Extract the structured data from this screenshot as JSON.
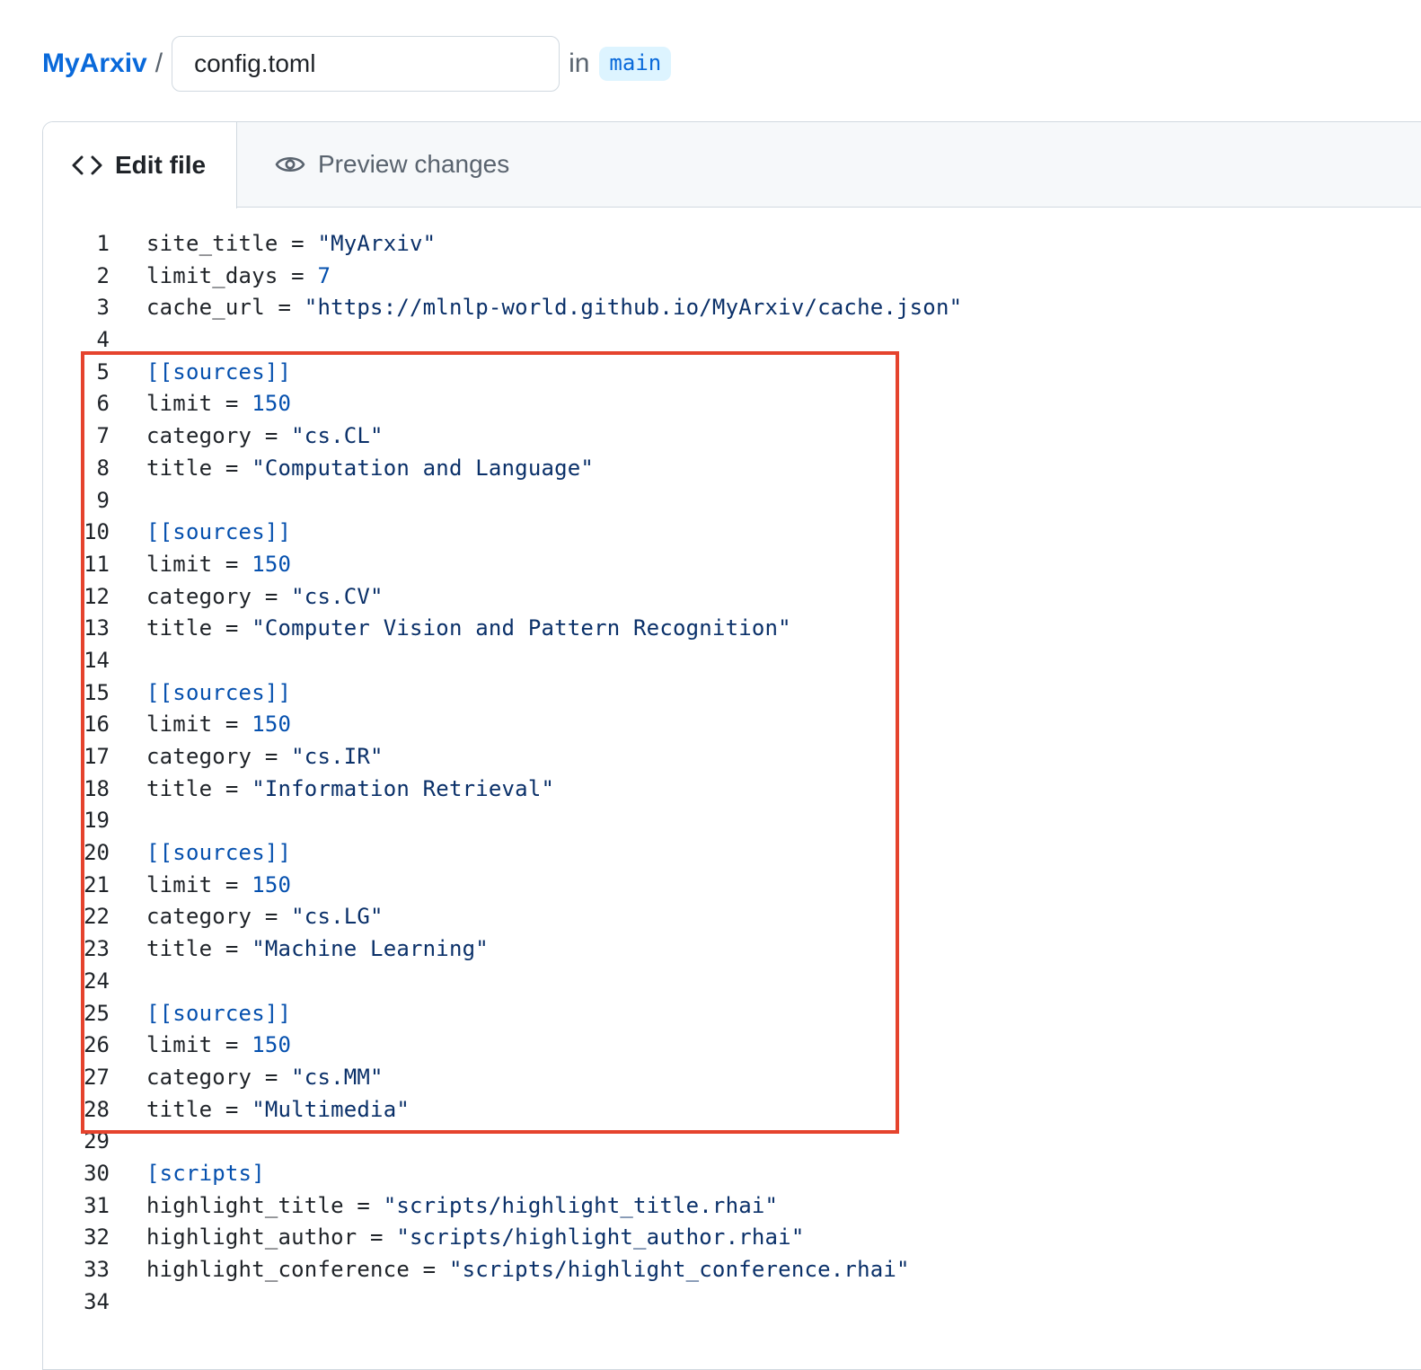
{
  "breadcrumb": {
    "repo": "MyArxiv",
    "separator": "/",
    "filename": "config.toml",
    "in_label": "in",
    "branch": "main"
  },
  "tabs": {
    "edit": {
      "label": "Edit file",
      "icon": "code-icon",
      "active": true
    },
    "preview": {
      "label": "Preview changes",
      "icon": "eye-icon",
      "active": false
    }
  },
  "code_lines": [
    {
      "n": "1",
      "tokens": [
        {
          "t": "site_title",
          "c": "key"
        },
        {
          "t": " = ",
          "c": "op"
        },
        {
          "t": "\"MyArxiv\"",
          "c": "str"
        }
      ]
    },
    {
      "n": "2",
      "tokens": [
        {
          "t": "limit_days",
          "c": "key"
        },
        {
          "t": " = ",
          "c": "op"
        },
        {
          "t": "7",
          "c": "num"
        }
      ]
    },
    {
      "n": "3",
      "tokens": [
        {
          "t": "cache_url",
          "c": "key"
        },
        {
          "t": " = ",
          "c": "op"
        },
        {
          "t": "\"https://mlnlp-world.github.io/MyArxiv/cache.json\"",
          "c": "str"
        }
      ]
    },
    {
      "n": "4",
      "tokens": []
    },
    {
      "n": "5",
      "tokens": [
        {
          "t": "[[sources]]",
          "c": "sec"
        }
      ]
    },
    {
      "n": "6",
      "tokens": [
        {
          "t": "limit",
          "c": "key"
        },
        {
          "t": " = ",
          "c": "op"
        },
        {
          "t": "150",
          "c": "num"
        }
      ]
    },
    {
      "n": "7",
      "tokens": [
        {
          "t": "category",
          "c": "key"
        },
        {
          "t": " = ",
          "c": "op"
        },
        {
          "t": "\"cs.CL\"",
          "c": "str"
        }
      ]
    },
    {
      "n": "8",
      "tokens": [
        {
          "t": "title",
          "c": "key"
        },
        {
          "t": " = ",
          "c": "op"
        },
        {
          "t": "\"Computation and Language\"",
          "c": "str"
        }
      ]
    },
    {
      "n": "9",
      "tokens": []
    },
    {
      "n": "10",
      "tokens": [
        {
          "t": "[[sources]]",
          "c": "sec"
        }
      ]
    },
    {
      "n": "11",
      "tokens": [
        {
          "t": "limit",
          "c": "key"
        },
        {
          "t": " = ",
          "c": "op"
        },
        {
          "t": "150",
          "c": "num"
        }
      ]
    },
    {
      "n": "12",
      "tokens": [
        {
          "t": "category",
          "c": "key"
        },
        {
          "t": " = ",
          "c": "op"
        },
        {
          "t": "\"cs.CV\"",
          "c": "str"
        }
      ]
    },
    {
      "n": "13",
      "tokens": [
        {
          "t": "title",
          "c": "key"
        },
        {
          "t": " = ",
          "c": "op"
        },
        {
          "t": "\"Computer Vision and Pattern Recognition\"",
          "c": "str"
        }
      ]
    },
    {
      "n": "14",
      "tokens": []
    },
    {
      "n": "15",
      "tokens": [
        {
          "t": "[[sources]]",
          "c": "sec"
        }
      ]
    },
    {
      "n": "16",
      "tokens": [
        {
          "t": "limit",
          "c": "key"
        },
        {
          "t": " = ",
          "c": "op"
        },
        {
          "t": "150",
          "c": "num"
        }
      ]
    },
    {
      "n": "17",
      "tokens": [
        {
          "t": "category",
          "c": "key"
        },
        {
          "t": " = ",
          "c": "op"
        },
        {
          "t": "\"cs.IR\"",
          "c": "str"
        }
      ]
    },
    {
      "n": "18",
      "tokens": [
        {
          "t": "title",
          "c": "key"
        },
        {
          "t": " = ",
          "c": "op"
        },
        {
          "t": "\"Information Retrieval\"",
          "c": "str"
        }
      ]
    },
    {
      "n": "19",
      "tokens": []
    },
    {
      "n": "20",
      "tokens": [
        {
          "t": "[[sources]]",
          "c": "sec"
        }
      ]
    },
    {
      "n": "21",
      "tokens": [
        {
          "t": "limit",
          "c": "key"
        },
        {
          "t": " = ",
          "c": "op"
        },
        {
          "t": "150",
          "c": "num"
        }
      ]
    },
    {
      "n": "22",
      "tokens": [
        {
          "t": "category",
          "c": "key"
        },
        {
          "t": " = ",
          "c": "op"
        },
        {
          "t": "\"cs.LG\"",
          "c": "str"
        }
      ]
    },
    {
      "n": "23",
      "tokens": [
        {
          "t": "title",
          "c": "key"
        },
        {
          "t": " = ",
          "c": "op"
        },
        {
          "t": "\"Machine Learning\"",
          "c": "str"
        }
      ]
    },
    {
      "n": "24",
      "tokens": []
    },
    {
      "n": "25",
      "tokens": [
        {
          "t": "[[sources]]",
          "c": "sec"
        }
      ]
    },
    {
      "n": "26",
      "tokens": [
        {
          "t": "limit",
          "c": "key"
        },
        {
          "t": " = ",
          "c": "op"
        },
        {
          "t": "150",
          "c": "num"
        }
      ]
    },
    {
      "n": "27",
      "tokens": [
        {
          "t": "category",
          "c": "key"
        },
        {
          "t": " = ",
          "c": "op"
        },
        {
          "t": "\"cs.MM\"",
          "c": "str"
        }
      ]
    },
    {
      "n": "28",
      "tokens": [
        {
          "t": "title",
          "c": "key"
        },
        {
          "t": " = ",
          "c": "op"
        },
        {
          "t": "\"Multimedia\"",
          "c": "str"
        }
      ]
    },
    {
      "n": "29",
      "tokens": []
    },
    {
      "n": "30",
      "tokens": [
        {
          "t": "[scripts]",
          "c": "sec"
        }
      ]
    },
    {
      "n": "31",
      "tokens": [
        {
          "t": "highlight_title",
          "c": "key"
        },
        {
          "t": " = ",
          "c": "op"
        },
        {
          "t": "\"scripts/highlight_title.rhai\"",
          "c": "str"
        }
      ]
    },
    {
      "n": "32",
      "tokens": [
        {
          "t": "highlight_author",
          "c": "key"
        },
        {
          "t": " = ",
          "c": "op"
        },
        {
          "t": "\"scripts/highlight_author.rhai\"",
          "c": "str"
        }
      ]
    },
    {
      "n": "33",
      "tokens": [
        {
          "t": "highlight_conference",
          "c": "key"
        },
        {
          "t": " = ",
          "c": "op"
        },
        {
          "t": "\"scripts/highlight_conference.rhai\"",
          "c": "str"
        }
      ]
    },
    {
      "n": "34",
      "tokens": []
    }
  ],
  "annotation": {
    "color": "#e5432d",
    "covers_lines": [
      "5",
      "28"
    ]
  },
  "colors": {
    "link": "#0969da",
    "string": "#0a3069",
    "number": "#0550ae",
    "section": "#0550ae",
    "branch_bg": "#ddf4ff"
  }
}
